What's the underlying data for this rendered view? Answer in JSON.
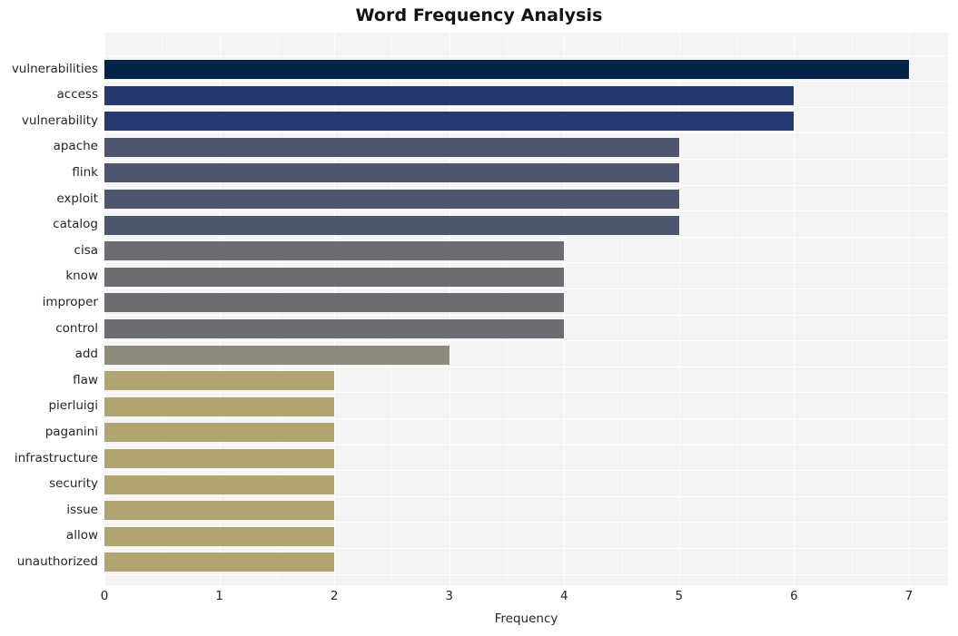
{
  "chart_data": {
    "type": "bar",
    "orientation": "horizontal",
    "title": "Word Frequency Analysis",
    "xlabel": "Frequency",
    "ylabel": "",
    "xlim": [
      0,
      7.34
    ],
    "xticks": [
      0,
      1,
      2,
      3,
      4,
      5,
      6,
      7
    ],
    "xtick_labels": [
      "0",
      "1",
      "2",
      "3",
      "4",
      "5",
      "6",
      "7"
    ],
    "grid": true,
    "legend": "none",
    "categories": [
      "vulnerabilities",
      "access",
      "vulnerability",
      "apache",
      "flink",
      "exploit",
      "catalog",
      "cisa",
      "know",
      "improper",
      "control",
      "add",
      "flaw",
      "pierluigi",
      "paganini",
      "infrastructure",
      "security",
      "issue",
      "allow",
      "unauthorized"
    ],
    "values": [
      7,
      6,
      6,
      5,
      5,
      5,
      5,
      4,
      4,
      4,
      4,
      3,
      2,
      2,
      2,
      2,
      2,
      2,
      2,
      2
    ],
    "bar_colors": [
      "#042349",
      "#25396e",
      "#253a70",
      "#4e566e",
      "#4e566e",
      "#4e566e",
      "#4e566e",
      "#6b6d72",
      "#6b6d72",
      "#6b6d72",
      "#6b6d72",
      "#8d8a7b",
      "#b0a470",
      "#b0a470",
      "#b0a470",
      "#b0a470",
      "#b0a470",
      "#b0a470",
      "#b0a470",
      "#b0a470"
    ]
  },
  "style": {
    "figure_background": "#ffffff",
    "plot_background": "#f4f4f5",
    "grid_color": "#ffffff",
    "text_color": "#262626",
    "title_color": "#111111"
  }
}
